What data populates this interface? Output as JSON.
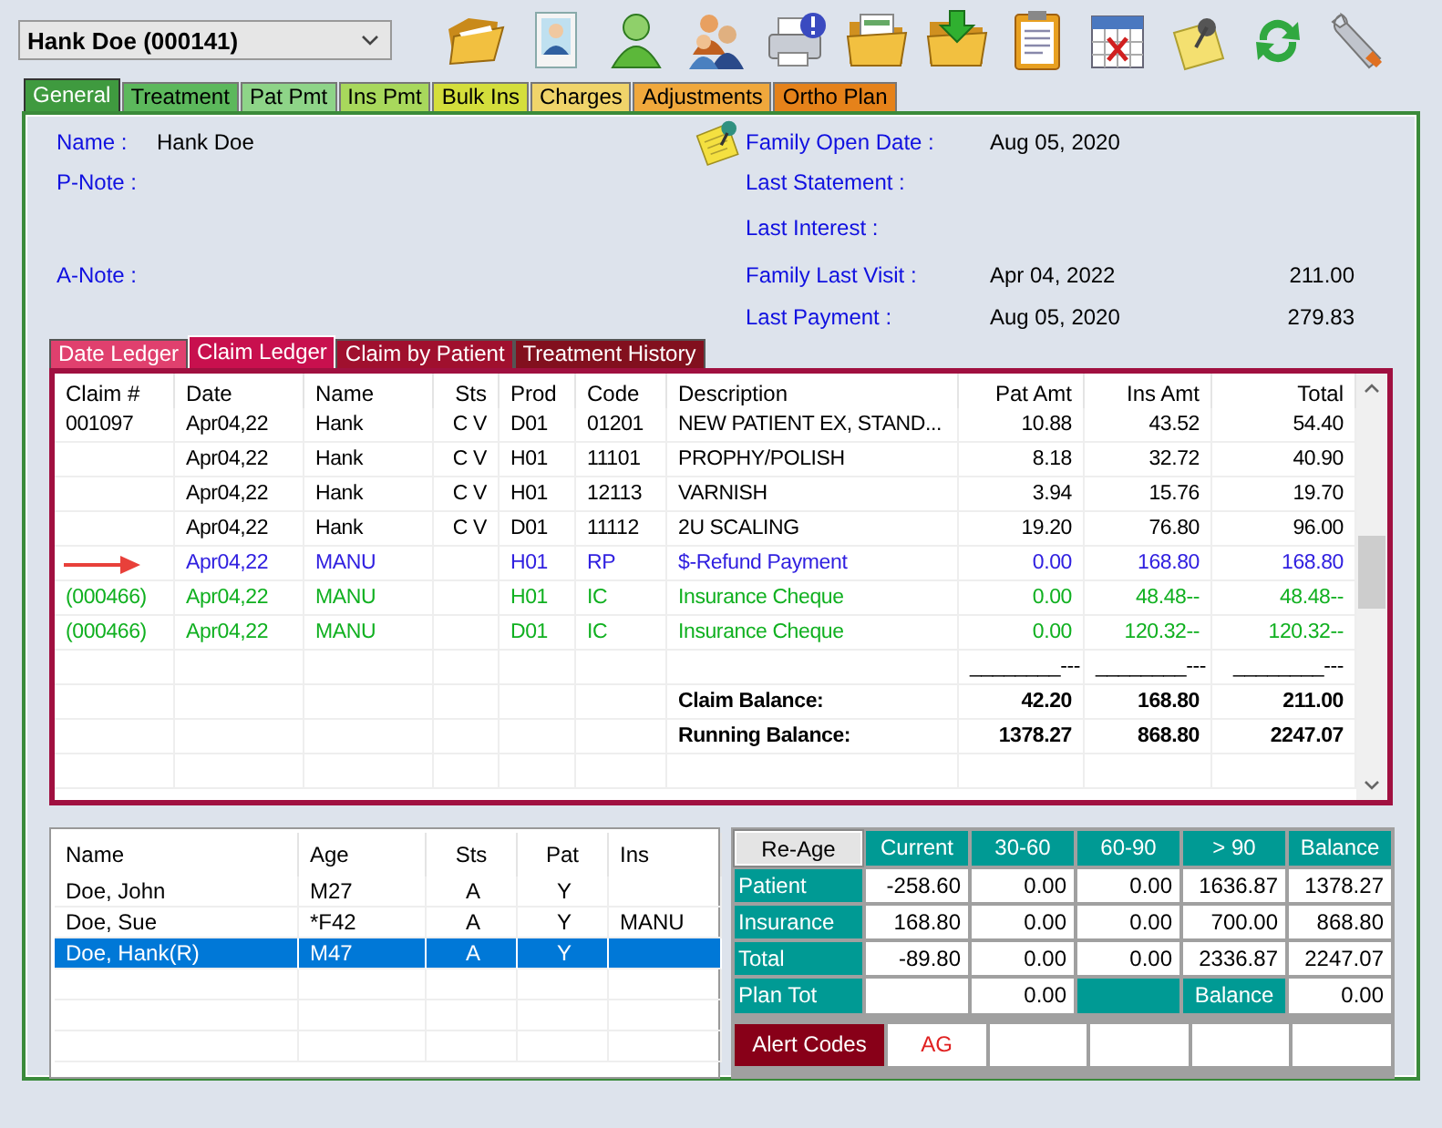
{
  "patient_select": {
    "value": "Hank Doe (000141)"
  },
  "tabs": [
    {
      "label": "General",
      "color": "#3f9a3f",
      "selected": true
    },
    {
      "label": "Treatment",
      "color": "#5cb85c",
      "selected": false
    },
    {
      "label": "Pat Pmt",
      "color": "#8ed488",
      "selected": false
    },
    {
      "label": "Ins Pmt",
      "color": "#a8d85c",
      "selected": false
    },
    {
      "label": "Bulk Ins",
      "color": "#d4de3c",
      "selected": false
    },
    {
      "label": "Charges",
      "color": "#f0d46a",
      "selected": false
    },
    {
      "label": "Adjustments",
      "color": "#f0a83c",
      "selected": false
    },
    {
      "label": "Ortho Plan",
      "color": "#e5821a",
      "selected": false
    }
  ],
  "info": {
    "fields": [
      {
        "label": "Name :",
        "value": "Hank Doe"
      },
      {
        "label": "P-Note :"
      },
      {
        "label": "A-Note :"
      }
    ],
    "family": [
      {
        "label": "Family Open Date :",
        "date": "Aug 05, 2020"
      },
      {
        "label": "Last Statement :"
      },
      {
        "label": "Last Interest :"
      },
      {
        "label": "Family Last Visit :",
        "date": "Apr 04, 2022",
        "amount": "211.00"
      },
      {
        "label": "Last Payment :",
        "date": "Aug 05, 2020",
        "amount": "279.83"
      }
    ]
  },
  "ledger_tabs": [
    {
      "label": "Date Ledger",
      "color": "#e0406e",
      "selected": false
    },
    {
      "label": "Claim Ledger",
      "color": "#c8104e",
      "selected": true
    },
    {
      "label": "Claim by Patient",
      "color": "#a0102e",
      "selected": false
    },
    {
      "label": "Treatment History",
      "color": "#82101e",
      "selected": false
    }
  ],
  "ledger": {
    "columns": [
      "Claim #",
      "Date",
      "Name",
      "Sts",
      "Prod",
      "Code",
      "Description",
      "Pat Amt",
      "Ins Amt",
      "Total"
    ],
    "rows": [
      {
        "kind": "charge",
        "flagged": false,
        "claim": "001097",
        "date": "Apr04,22",
        "name": "Hank",
        "sts": "C V",
        "prod": "D01",
        "code": "01201",
        "description": "NEW PATIENT EX, STAND...",
        "pat_amt": "10.88",
        "ins_amt": "43.52",
        "total": "54.40"
      },
      {
        "kind": "charge",
        "flagged": false,
        "date": "Apr04,22",
        "name": "Hank",
        "sts": "C V",
        "prod": "H01",
        "code": "11101",
        "description": "PROPHY/POLISH",
        "pat_amt": "8.18",
        "ins_amt": "32.72",
        "total": "40.90"
      },
      {
        "kind": "charge",
        "flagged": false,
        "date": "Apr04,22",
        "name": "Hank",
        "sts": "C V",
        "prod": "H01",
        "code": "12113",
        "description": "VARNISH",
        "pat_amt": "3.94",
        "ins_amt": "15.76",
        "total": "19.70"
      },
      {
        "kind": "charge",
        "flagged": false,
        "date": "Apr04,22",
        "name": "Hank",
        "sts": "C V",
        "prod": "D01",
        "code": "11112",
        "description": "2U SCALING",
        "pat_amt": "19.20",
        "ins_amt": "76.80",
        "total": "96.00"
      },
      {
        "kind": "refund",
        "flagged": true,
        "date": "Apr04,22",
        "name": "MANU",
        "prod": "H01",
        "code": "RP",
        "description": "$-Refund Payment",
        "pat_amt": "0.00",
        "ins_amt": "168.80",
        "total": "168.80"
      },
      {
        "kind": "insurance",
        "flagged": false,
        "claim": "(000466)",
        "date": "Apr04,22",
        "name": "MANU",
        "prod": "H01",
        "code": "IC",
        "description": "Insurance Cheque",
        "pat_amt": "0.00",
        "ins_amt": "48.48--",
        "total": "48.48--"
      },
      {
        "kind": "insurance",
        "flagged": false,
        "claim": "(000466)",
        "date": "Apr04,22",
        "name": "MANU",
        "prod": "D01",
        "code": "IC",
        "description": "Insurance Cheque",
        "pat_amt": "0.00",
        "ins_amt": "120.32--",
        "total": "120.32--"
      }
    ],
    "separator": [
      "________---",
      "________---",
      "________---"
    ],
    "balances": [
      {
        "label": "Claim Balance:",
        "values": [
          "42.20",
          "168.80",
          "211.00"
        ]
      },
      {
        "label": "Running Balance:",
        "values": [
          "1378.27",
          "868.80",
          "2247.07"
        ]
      }
    ]
  },
  "family": {
    "columns": [
      "Name",
      "Age",
      "Sts",
      "Pat",
      "Ins"
    ],
    "rows": [
      {
        "name": "Doe, John",
        "age": "M27",
        "sts": "A",
        "pat": "Y",
        "selected": false
      },
      {
        "name": "Doe, Sue",
        "age": "*F42",
        "sts": "A",
        "pat": "Y",
        "ins": "MANU",
        "selected": false
      },
      {
        "name": "Doe, Hank(R)",
        "age": "M47",
        "sts": "A",
        "pat": "Y",
        "selected": true
      }
    ]
  },
  "aging": {
    "reage_button": "Re-Age",
    "columns": [
      "Current",
      "30-60",
      "60-90",
      "> 90",
      "Balance"
    ],
    "rows": [
      {
        "label": "Patient",
        "values": [
          "-258.60",
          "0.00",
          "0.00",
          "1636.87",
          "1378.27"
        ]
      },
      {
        "label": "Insurance",
        "values": [
          "168.80",
          "0.00",
          "0.00",
          "700.00",
          "868.80"
        ]
      },
      {
        "label": "Total",
        "values": [
          "-89.80",
          "0.00",
          "0.00",
          "2336.87",
          "2247.07"
        ]
      }
    ],
    "plan_row": {
      "label": "Plan Tot",
      "cells": [
        {
          "kind": "empty"
        },
        {
          "kind": "value",
          "text": "0.00"
        },
        {
          "kind": "shade"
        },
        {
          "kind": "label",
          "text": "Balance"
        },
        {
          "kind": "value",
          "text": "0.00"
        }
      ]
    },
    "alerts": {
      "label": "Alert Codes",
      "codes": [
        "AG"
      ]
    }
  }
}
